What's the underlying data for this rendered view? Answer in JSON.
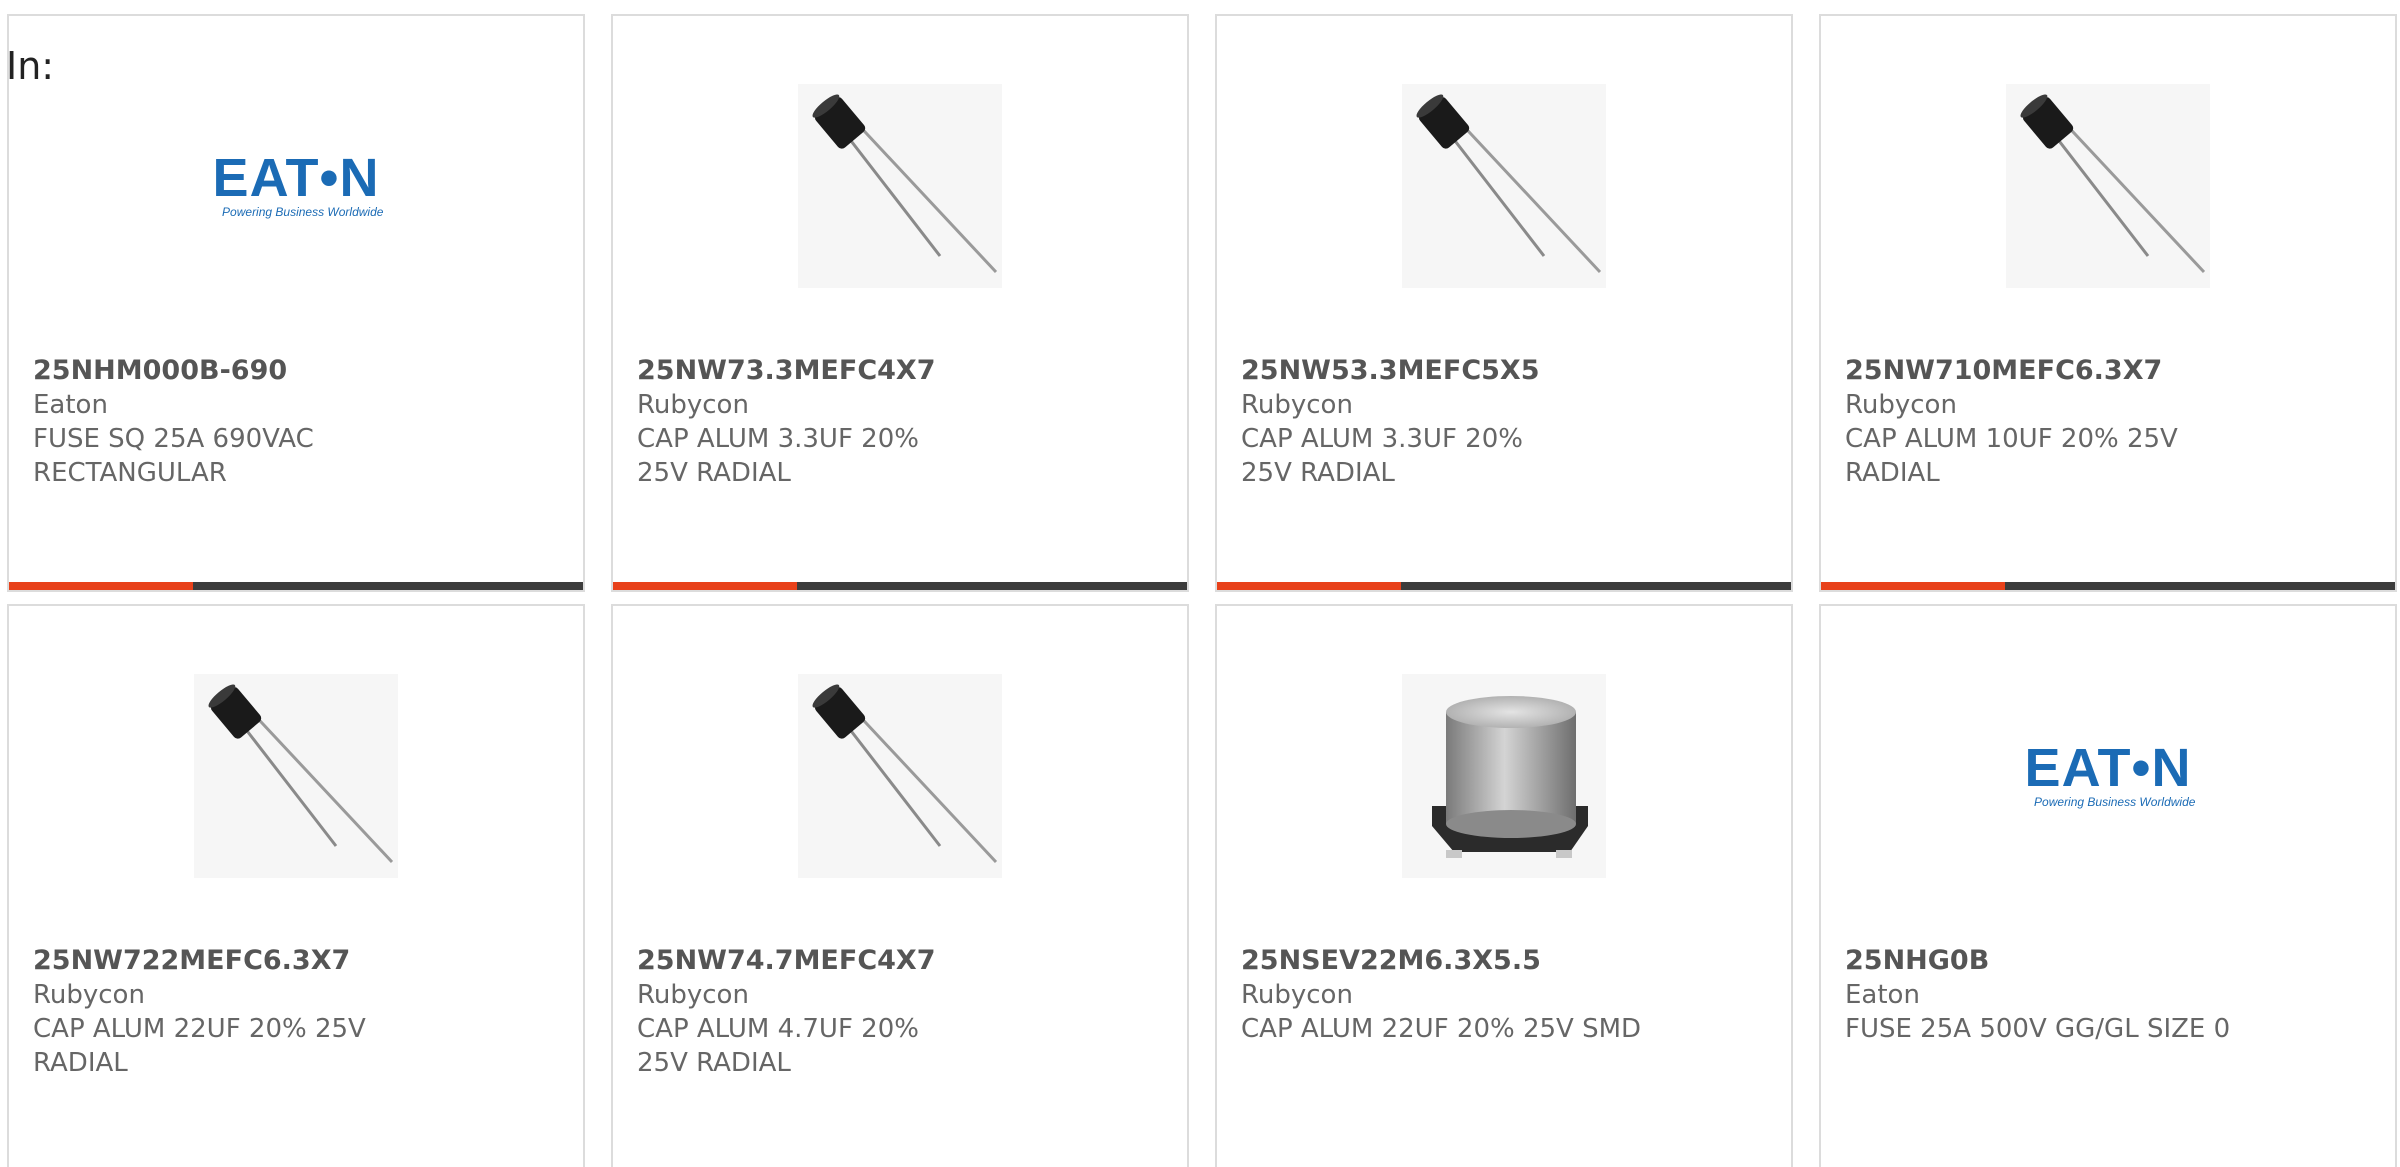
{
  "search": {
    "label": "In:"
  },
  "brand": {
    "accent": "#e8411a",
    "bar_dark": "#3c3c3c",
    "eaton_blue": "#1b6bb5"
  },
  "logos": {
    "eaton": {
      "wordmark": "EAT•N",
      "tagline": "Powering Business Worldwide"
    }
  },
  "products": [
    {
      "part": "25NHM000B-690",
      "manufacturer": "Eaton",
      "description": "FUSE SQ 25A 690VAC RECTANGULAR",
      "image": "eaton-logo"
    },
    {
      "part": "25NW73.3MEFC4X7",
      "manufacturer": "Rubycon",
      "description": "CAP ALUM 3.3UF 20% 25V RADIAL",
      "image": "radial-capacitor"
    },
    {
      "part": "25NW53.3MEFC5X5",
      "manufacturer": "Rubycon",
      "description": "CAP ALUM 3.3UF 20% 25V RADIAL",
      "image": "radial-capacitor"
    },
    {
      "part": "25NW710MEFC6.3X7",
      "manufacturer": "Rubycon",
      "description": "CAP ALUM 10UF 20% 25V RADIAL",
      "image": "radial-capacitor"
    },
    {
      "part": "25NW722MEFC6.3X7",
      "manufacturer": "Rubycon",
      "description": "CAP ALUM 22UF 20% 25V RADIAL",
      "image": "radial-capacitor"
    },
    {
      "part": "25NW74.7MEFC4X7",
      "manufacturer": "Rubycon",
      "description": "CAP ALUM 4.7UF 20% 25V RADIAL",
      "image": "radial-capacitor"
    },
    {
      "part": "25NSEV22M6.3X5.5",
      "manufacturer": "Rubycon",
      "description": "CAP ALUM 22UF 20% 25V SMD",
      "image": "smd-capacitor"
    },
    {
      "part": "25NHG0B",
      "manufacturer": "Eaton",
      "description": "FUSE 25A 500V GG/GL SIZE 0",
      "image": "eaton-logo"
    }
  ]
}
